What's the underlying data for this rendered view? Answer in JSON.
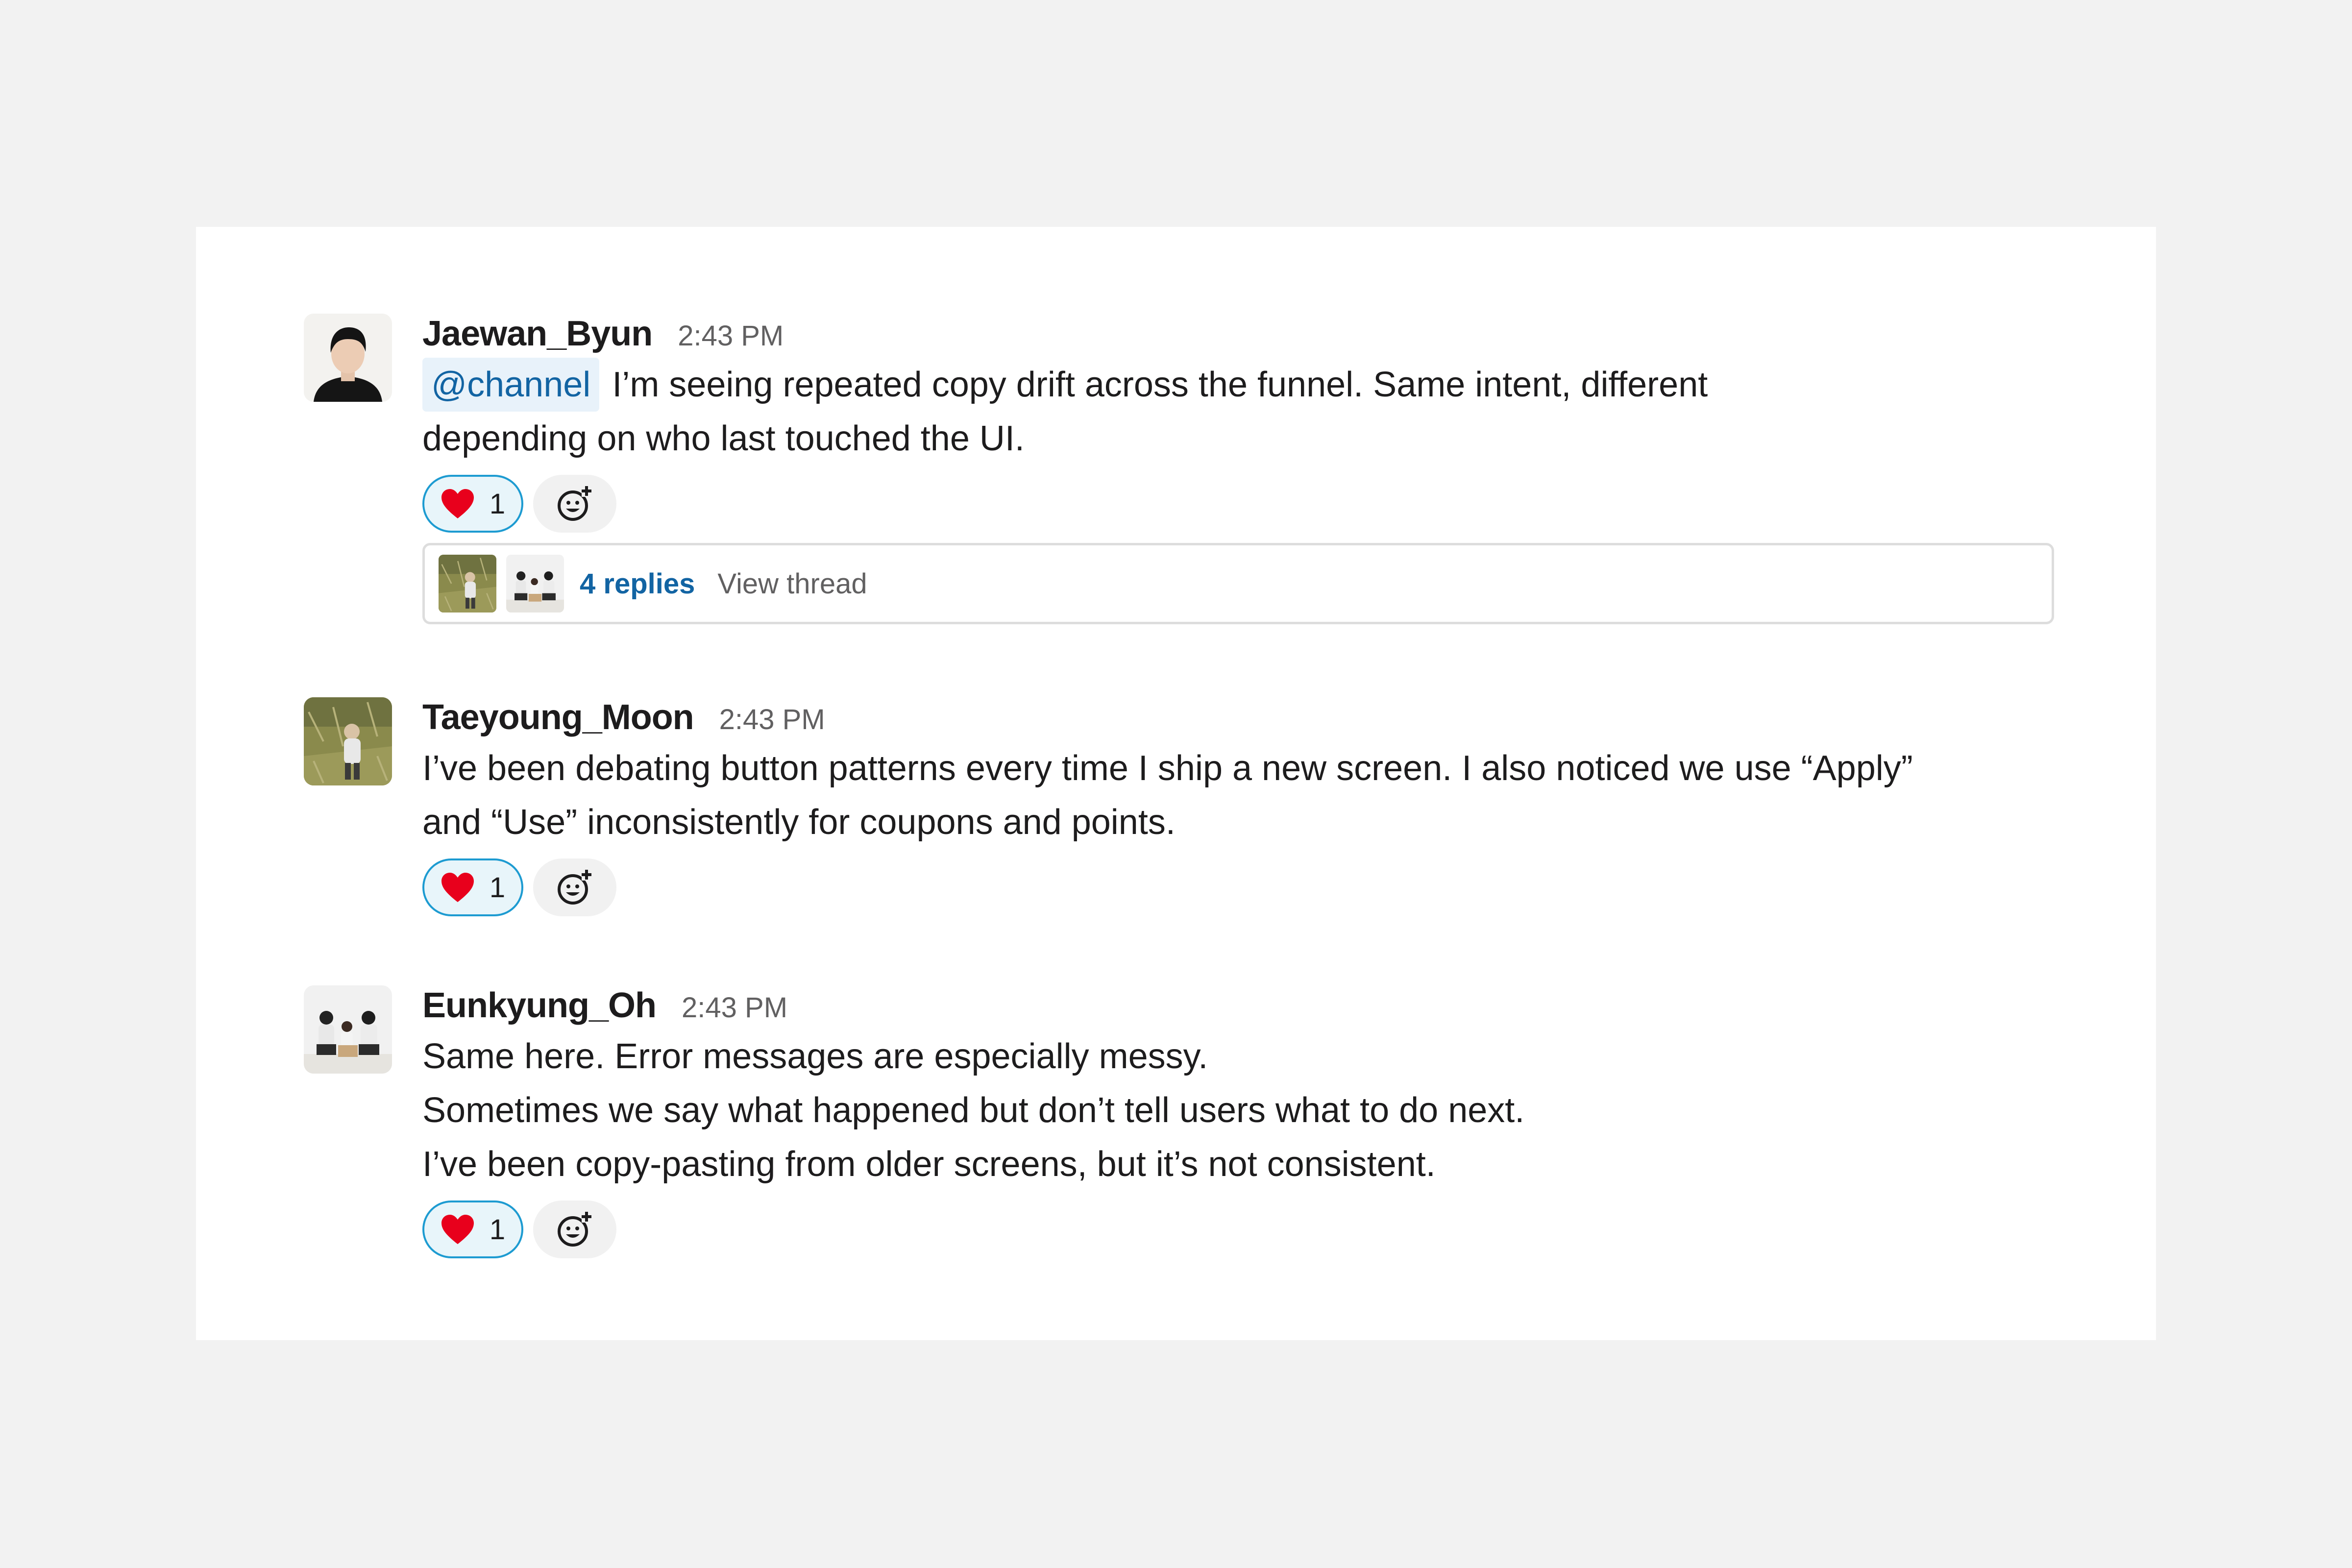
{
  "colors": {
    "page_background": "#f2f2f2",
    "card_background": "#ffffff",
    "mention_background": "#e8f2fa",
    "mention_text": "#1264a3",
    "link": "#1264a3",
    "reaction_border": "#1d9bd1",
    "heart": "#e01e5a"
  },
  "messages": [
    {
      "username": "Jaewan_Byun",
      "time": "2:43 PM",
      "avatar_icon": "person-portrait-avatar",
      "mention": "@channel",
      "lines": [
        "I’m seeing repeated copy drift across the funnel. Same intent, different",
        "depending on who last touched the UI."
      ],
      "reaction": {
        "icon": "heart-icon",
        "count": "1"
      },
      "thread": {
        "replies_label": "4 replies",
        "view_label": "View thread"
      }
    },
    {
      "username": "Taeyoung_Moon",
      "time": "2:43 PM",
      "avatar_icon": "outdoor-photo-avatar",
      "lines": [
        "I’ve been debating button patterns every time I ship a new screen. I also noticed we use “Apply”",
        "and “Use” inconsistently for coupons and points."
      ],
      "reaction": {
        "icon": "heart-icon",
        "count": "1"
      }
    },
    {
      "username": "Eunkyung_Oh",
      "time": "2:43 PM",
      "avatar_icon": "group-photo-avatar",
      "lines": [
        "Same here. Error messages are especially messy.",
        "Sometimes we say what happened but don’t tell users what to do next.",
        "I’ve been copy-pasting from older screens, but it’s not consistent."
      ],
      "reaction": {
        "icon": "heart-icon",
        "count": "1"
      }
    }
  ]
}
